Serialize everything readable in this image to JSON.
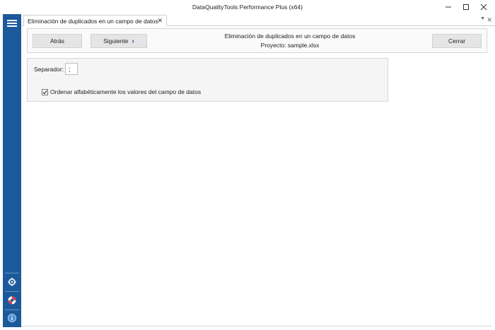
{
  "window": {
    "title": "DataQualityTools Performance Plus (x64)"
  },
  "tabs": [
    {
      "label": "Eliminación de duplicados en un campo de datos"
    }
  ],
  "toolbar": {
    "back_label": "Atrás",
    "next_label": "Siguiente",
    "close_label": "Cerrar",
    "function_title": "Eliminación de duplicados en un campo de datos",
    "project": "Proyecto: sample.xlsx"
  },
  "options": {
    "separator_label": "Separador:",
    "separator_value": ";",
    "sort_label": "Ordenar alfabéticamente los valores del campo de datos",
    "sort_checked": true
  },
  "sidebar": {
    "icons": [
      "menu-icon",
      "settings-icon",
      "help-lifebuoy-icon",
      "info-icon"
    ]
  },
  "colors": {
    "sidebar": "#1b5a9a",
    "accent": "#1b5a9a"
  }
}
